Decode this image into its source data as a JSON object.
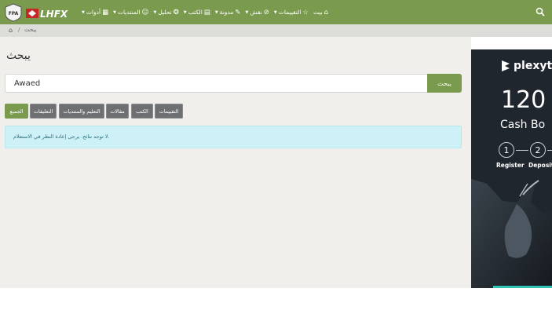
{
  "header": {
    "logo_fpa": "FPA",
    "logo_lhfx": "LHFX",
    "nav": [
      {
        "label": "بيت",
        "icon": "home-icon",
        "caret": false
      },
      {
        "label": "التقييمات",
        "icon": "star-icon",
        "caret": true
      },
      {
        "label": "نقش",
        "icon": "ban-icon",
        "caret": true
      },
      {
        "label": "مدونة",
        "icon": "pencil-icon",
        "caret": true
      },
      {
        "label": "الكتب",
        "icon": "book-icon",
        "caret": true
      },
      {
        "label": "تحليل",
        "icon": "brain-icon",
        "caret": true
      },
      {
        "label": "المنتديات",
        "icon": "users-icon",
        "caret": true
      },
      {
        "label": "أدوات",
        "icon": "calculator-icon",
        "caret": true
      }
    ],
    "search_icon": "search-icon",
    "accent": "#7a9a4e"
  },
  "breadcrumb": {
    "home_icon": "home-icon",
    "separator": "/",
    "current": "يبحث"
  },
  "page": {
    "title": "يبحث",
    "search_value": "Awaed",
    "search_button": "يبحث",
    "filters": [
      "الجميع",
      "التقييمات",
      "التعليم والمنتديات",
      "مقالات",
      "الكتب",
      "التعليقات"
    ],
    "alert": "لا توجد نتائج. يرجى إعادة النظر في الاستعلام.",
    "alert_bg": "#cdf1f7"
  },
  "ad": {
    "brand": "plexytr",
    "amount": "120",
    "subtitle": "Cash Bo",
    "steps": [
      "1",
      "2"
    ],
    "step_labels": [
      "Register",
      "Deposit"
    ],
    "accent": "#2ec4b6"
  }
}
